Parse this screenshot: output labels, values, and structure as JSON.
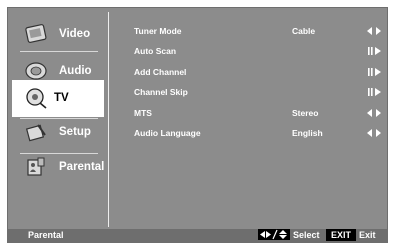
{
  "sidebar": {
    "items": [
      {
        "label": "Video",
        "icon": "video-icon"
      },
      {
        "label": "Audio",
        "icon": "audio-icon"
      },
      {
        "label": "TV",
        "icon": "tv-icon",
        "selected": true
      },
      {
        "label": "Setup",
        "icon": "setup-icon"
      },
      {
        "label": "Parental",
        "icon": "parental-icon"
      }
    ]
  },
  "menu": {
    "rows": [
      {
        "name": "Tuner Mode",
        "value": "Cable",
        "control": "left-right-arrows"
      },
      {
        "name": "Auto Scan",
        "value": "",
        "control": "enter-arrow"
      },
      {
        "name": "Add Channel",
        "value": "",
        "control": "enter-arrow"
      },
      {
        "name": "Channel Skip",
        "value": "",
        "control": "enter-arrow"
      },
      {
        "name": "MTS",
        "value": "Stereo",
        "control": "left-right-arrows"
      },
      {
        "name": "Audio Language",
        "value": "English",
        "control": "left-right-arrows"
      }
    ]
  },
  "status": {
    "title": "Parental",
    "select_label": "Select",
    "exit_key": "EXIT",
    "exit_label": "Exit"
  },
  "colors": {
    "panel": "#8c8c8c",
    "status_bar": "#6e6e6e",
    "text": "#ffffff",
    "selected_bg": "#ffffff"
  }
}
